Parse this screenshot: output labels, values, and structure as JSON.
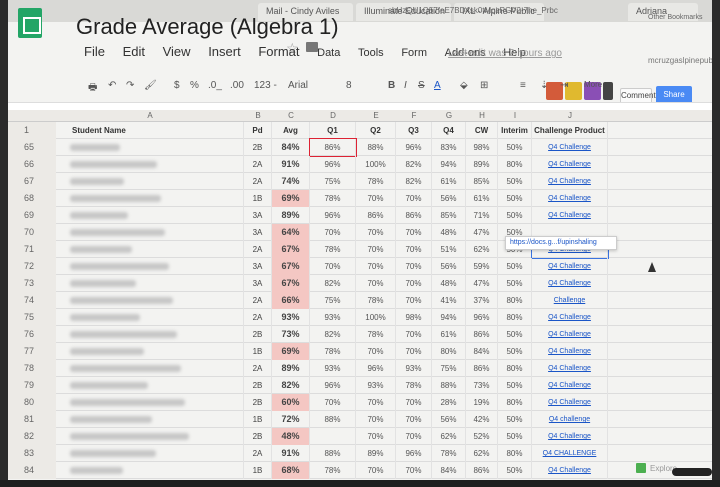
{
  "browser": {
    "tabs": [
      {
        "label": "Mail - Cindy Aviles"
      },
      {
        "label": "Illuminate Education"
      },
      {
        "label": "IXL - Alpine Public"
      },
      {
        "label": "Adriana"
      }
    ],
    "url": "sbHzQU1Q57feE7BD4sk0tMqzPGV2-7he_Prbc",
    "bookmark": "Other Bookmarks"
  },
  "document": {
    "title": "Grade Average (Algebra 1)",
    "last_edit": "Last edit was 2 hours ago",
    "account": "mcruzgaslpinepublicschools.org"
  },
  "menu": [
    "File",
    "Edit",
    "View",
    "Insert",
    "Format",
    "Data",
    "Tools",
    "Form",
    "Add-ons",
    "Help"
  ],
  "toolbar": {
    "currency": "$",
    "percent": "%",
    "decimal_less": ".0_",
    "decimal_more": ".00",
    "number_format": "123 -",
    "font": "Arial",
    "font_size": "8",
    "bold": "B",
    "italic": "I",
    "strike": "S",
    "text_color": "A",
    "more": "More"
  },
  "buttons": {
    "comments": "Comments",
    "share": "Share"
  },
  "columns": [
    "A",
    "B",
    "C",
    "D",
    "E",
    "F",
    "G",
    "H",
    "I",
    "J"
  ],
  "headers": {
    "student": "Student Name",
    "pd": "Pd",
    "avg": "Avg",
    "q1": "Q1",
    "q2": "Q2",
    "q3": "Q3",
    "q4": "Q4",
    "cw": "CW",
    "interim": "Interim",
    "challenge": "Challenge Product"
  },
  "header_row_number": "1",
  "rows": [
    {
      "n": "65",
      "pd": "2B",
      "avg": "84%",
      "low": false,
      "q1": "86%",
      "q2": "88%",
      "q3": "96%",
      "q4": "83%",
      "cw": "98%",
      "interim": "50%",
      "link": "Q4 Challenge"
    },
    {
      "n": "66",
      "pd": "2A",
      "avg": "91%",
      "low": false,
      "q1": "96%",
      "q2": "100%",
      "q3": "82%",
      "q4": "94%",
      "cw": "89%",
      "interim": "80%",
      "link": "Q4 Challenge"
    },
    {
      "n": "67",
      "pd": "2A",
      "avg": "74%",
      "low": false,
      "q1": "75%",
      "q2": "78%",
      "q3": "82%",
      "q4": "61%",
      "cw": "85%",
      "interim": "50%",
      "link": "Q4 Challenge"
    },
    {
      "n": "68",
      "pd": "1B",
      "avg": "69%",
      "low": true,
      "q1": "78%",
      "q2": "70%",
      "q3": "70%",
      "q4": "56%",
      "cw": "61%",
      "interim": "50%",
      "link": "Q4 Challenge"
    },
    {
      "n": "69",
      "pd": "3A",
      "avg": "89%",
      "low": false,
      "q1": "96%",
      "q2": "86%",
      "q3": "86%",
      "q4": "85%",
      "cw": "71%",
      "interim": "50%",
      "link": "Q4 Challenge"
    },
    {
      "n": "70",
      "pd": "3A",
      "avg": "64%",
      "low": true,
      "q1": "70%",
      "q2": "70%",
      "q3": "70%",
      "q4": "48%",
      "cw": "47%",
      "interim": "50%",
      "link": ""
    },
    {
      "n": "71",
      "pd": "2A",
      "avg": "67%",
      "low": true,
      "q1": "78%",
      "q2": "70%",
      "q3": "70%",
      "q4": "51%",
      "cw": "62%",
      "interim": "50%",
      "link": "Q4 Challenge"
    },
    {
      "n": "72",
      "pd": "3A",
      "avg": "67%",
      "low": true,
      "q1": "70%",
      "q2": "70%",
      "q3": "70%",
      "q4": "56%",
      "cw": "59%",
      "interim": "50%",
      "link": "Q4 Challenge"
    },
    {
      "n": "73",
      "pd": "3A",
      "avg": "67%",
      "low": true,
      "q1": "82%",
      "q2": "70%",
      "q3": "70%",
      "q4": "48%",
      "cw": "47%",
      "interim": "50%",
      "link": "Q4 Challenge"
    },
    {
      "n": "74",
      "pd": "2A",
      "avg": "66%",
      "low": true,
      "q1": "75%",
      "q2": "78%",
      "q3": "70%",
      "q4": "41%",
      "cw": "37%",
      "interim": "80%",
      "link": "Challenge"
    },
    {
      "n": "75",
      "pd": "2A",
      "avg": "93%",
      "low": false,
      "q1": "93%",
      "q2": "100%",
      "q3": "98%",
      "q4": "94%",
      "cw": "96%",
      "interim": "80%",
      "link": "Q4 Challenge"
    },
    {
      "n": "76",
      "pd": "2B",
      "avg": "73%",
      "low": false,
      "q1": "82%",
      "q2": "78%",
      "q3": "70%",
      "q4": "61%",
      "cw": "86%",
      "interim": "50%",
      "link": "Q4 Challenge"
    },
    {
      "n": "77",
      "pd": "1B",
      "avg": "69%",
      "low": true,
      "q1": "78%",
      "q2": "70%",
      "q3": "70%",
      "q4": "80%",
      "cw": "84%",
      "interim": "50%",
      "link": "Q4 Challenge"
    },
    {
      "n": "78",
      "pd": "2A",
      "avg": "89%",
      "low": false,
      "q1": "93%",
      "q2": "96%",
      "q3": "93%",
      "q4": "75%",
      "cw": "86%",
      "interim": "80%",
      "link": "Q4 Challenge"
    },
    {
      "n": "79",
      "pd": "2B",
      "avg": "82%",
      "low": false,
      "q1": "96%",
      "q2": "93%",
      "q3": "78%",
      "q4": "88%",
      "cw": "73%",
      "interim": "50%",
      "link": "Q4 Challenge"
    },
    {
      "n": "80",
      "pd": "2B",
      "avg": "60%",
      "low": true,
      "q1": "70%",
      "q2": "70%",
      "q3": "70%",
      "q4": "28%",
      "cw": "19%",
      "interim": "80%",
      "link": "Q4 Challenge"
    },
    {
      "n": "81",
      "pd": "1B",
      "avg": "72%",
      "low": false,
      "q1": "88%",
      "q2": "70%",
      "q3": "70%",
      "q4": "56%",
      "cw": "42%",
      "interim": "50%",
      "link": "Q4 challenge"
    },
    {
      "n": "82",
      "pd": "2B",
      "avg": "48%",
      "low": true,
      "q1": "",
      "q2": "70%",
      "q3": "70%",
      "q4": "62%",
      "cw": "52%",
      "interim": "50%",
      "link": "Q4 Challenge"
    },
    {
      "n": "83",
      "pd": "2A",
      "avg": "91%",
      "low": false,
      "q1": "88%",
      "q2": "89%",
      "q3": "96%",
      "q4": "78%",
      "cw": "62%",
      "interim": "80%",
      "link": "Q4 CHALLENGE"
    },
    {
      "n": "84",
      "pd": "1B",
      "avg": "68%",
      "low": true,
      "q1": "78%",
      "q2": "70%",
      "q3": "70%",
      "q4": "84%",
      "cw": "86%",
      "interim": "50%",
      "link": "Q4 Challenge"
    }
  ],
  "tooltip": "https://docs.g...f/upinshaling",
  "explore": "Explore"
}
